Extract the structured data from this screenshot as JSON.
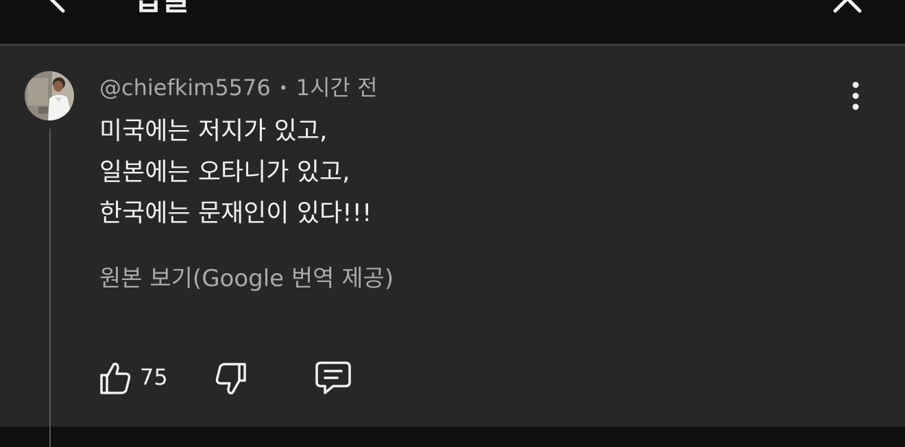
{
  "header": {
    "title": "답글",
    "back_icon": "chevron-left-icon",
    "close_icon": "close-icon"
  },
  "comment": {
    "author": "@chiefkim5576",
    "separator": "•",
    "time": "1시간 전",
    "lines": [
      "미국에는 저지가 있고,",
      "일본에는 오타니가 있고,",
      "한국에는 문재인이 있다!!!"
    ],
    "translate_link": "원본 보기(Google 번역 제공)",
    "like_count": "75",
    "more_icon": "more-vert-icon",
    "like_icon": "thumb-up-icon",
    "dislike_icon": "thumb-down-icon",
    "reply_icon": "reply-comment-icon"
  },
  "colors": {
    "background": "#0f0f0f",
    "panel": "#272727",
    "primary_text": "#f1f1f1",
    "secondary_text": "#aaaaaa"
  }
}
